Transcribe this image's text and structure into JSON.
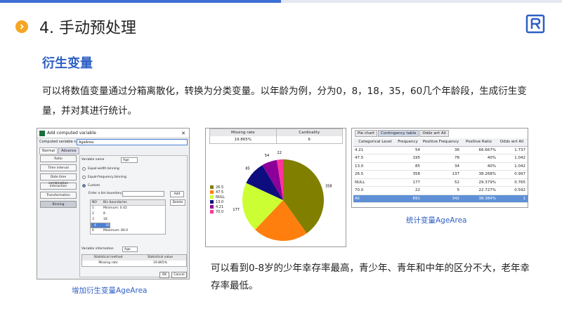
{
  "header": {
    "title": "4. 手动预处理"
  },
  "section": {
    "heading": "衍生变量",
    "intro": "可以将数值变量通过分箱离散化，转换为分类变量。以年龄为例，分为0，8，18，35，60几个年龄段，生成衍生变量，并对其进行统计。"
  },
  "dialog": {
    "title": "Add computed variable",
    "name_label": "Computed variable name",
    "name_value": "AgeArea",
    "tabs": [
      "Normal",
      "Advance"
    ],
    "left_buttons": [
      "Ratio",
      "Time interval",
      "Date time combination",
      "Interaction",
      "Transformation",
      "Binning"
    ],
    "variable_name_label": "Variable name",
    "variable_name_value": "Age",
    "equal_width": "Equal-width binning",
    "equal_freq": "Equal-frequency binning",
    "custom": "Custom",
    "enter_bin_label": "Enter a bin boundary",
    "add_button": "Add",
    "delete_button": "Delete",
    "bin_headers": [
      "NO",
      "Bin boundaries"
    ],
    "bins": [
      {
        "no": "1",
        "val": "Minimum: 0.42"
      },
      {
        "no": "2",
        "val": "8"
      },
      {
        "no": "3",
        "val": "18"
      },
      {
        "no": "4",
        "val": "35"
      },
      {
        "no": "5",
        "val": "60"
      },
      {
        "no": "6",
        "val": "Maximum: 80.0"
      }
    ],
    "selected_bin": 3,
    "var_info_label": "Variable information",
    "var_info_value": "Age",
    "stat_headers": [
      "Statistical method",
      "Statistical value"
    ],
    "stat_rows": [
      {
        "m": "Missing rate",
        "v": "19.865%"
      }
    ],
    "ok": "OK",
    "cancel": "Cancel"
  },
  "chart_panel": {
    "stat_headers": [
      "Missing rate",
      "Cardinality"
    ],
    "stat_values": [
      "19.865%",
      "6"
    ]
  },
  "chart_data": {
    "type": "pie",
    "categories": [
      "26.5",
      "47.5",
      "NULL",
      "13.0",
      "4.21",
      "70.0"
    ],
    "values": [
      358,
      195,
      177,
      85,
      54,
      22
    ],
    "colors": [
      "#807f00",
      "#ff7f0e",
      "#ccff33",
      "#0d0d80",
      "#8c0099",
      "#ff3399"
    ]
  },
  "contingency": {
    "tabs": [
      "Pie chart",
      "Contingency table",
      "Odds wrt All"
    ],
    "active_tab": 1,
    "headers": [
      "Categorical Level",
      "Frequency",
      "Positive Frequency",
      "Positive Ratio",
      "Odds wrt All"
    ],
    "rows": [
      [
        "4.21",
        "54",
        "36",
        "66.667%",
        "1.737"
      ],
      [
        "47.5",
        "195",
        "78",
        "40%",
        "1.042"
      ],
      [
        "13.0",
        "85",
        "34",
        "40%",
        "1.042"
      ],
      [
        "26.5",
        "358",
        "137",
        "38.268%",
        "0.997"
      ],
      [
        "NULL",
        "177",
        "52",
        "29.379%",
        "0.765"
      ],
      [
        "70.0",
        "22",
        "5",
        "22.727%",
        "0.592"
      ],
      [
        "All",
        "891",
        "342",
        "38.384%",
        "1"
      ]
    ]
  },
  "captions": {
    "left": "增加衍生变量AgeArea",
    "right": "统计变量AgeArea"
  },
  "conclusion": "可以看到0-8岁的少年幸存率最高，青少年、青年和中年的区分不大，老年幸存率最低。"
}
